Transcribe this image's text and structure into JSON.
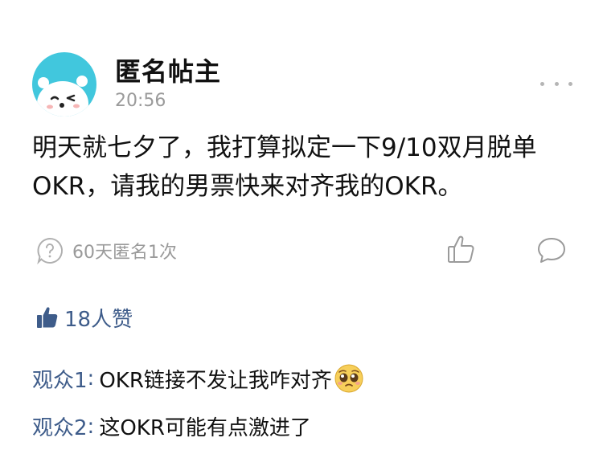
{
  "post": {
    "author": "匿名帖主",
    "time": "20:56",
    "content_lines": [
      "明天就七夕了，我打算拟定一下9/10双月脱单",
      "OKR，请我的男票快来对齐我的OKR。"
    ],
    "anon_note": "60天匿名1次"
  },
  "icons": {
    "avatar": "bear-avatar",
    "more": "more-icon",
    "anon": "question-bubble-icon",
    "like": "thumbs-up-icon",
    "comment": "comment-icon",
    "likes_thumb": "thumbs-up-filled-icon",
    "emoji": "pleading-face-emoji"
  },
  "likes": {
    "text": "18人赞"
  },
  "comments": [
    {
      "user": "观众1",
      "text": "OKR链接不发让我咋对齐"
    },
    {
      "user": "观众2",
      "text": "这OKR可能有点激进了"
    }
  ],
  "colors": {
    "avatar_bg": "#41c7dd",
    "link_blue": "#3e5c8a",
    "muted_gray": "#9a9a9a",
    "text": "#111111"
  }
}
